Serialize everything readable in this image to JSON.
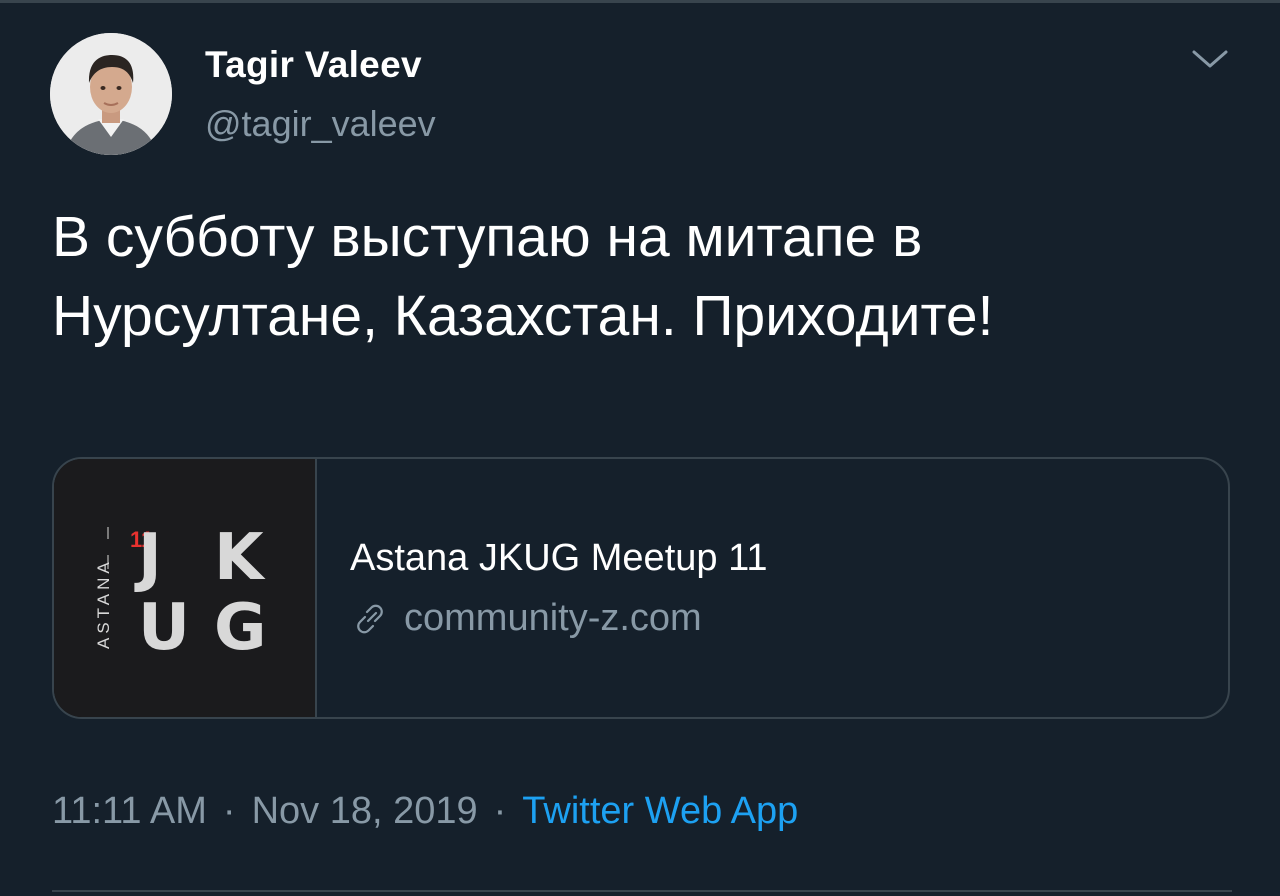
{
  "author": {
    "display_name": "Tagir Valeev",
    "handle": "@tagir_valeev",
    "avatar_icon": "person-photo"
  },
  "menu": {
    "caret_icon": "chevron-down-icon"
  },
  "tweet": {
    "text_lines": [
      "В субботу выступаю на митапе в",
      "Нурсултане, Казахстан. Приходите!"
    ]
  },
  "card": {
    "image_logo": {
      "vertical_text": "ASTANA",
      "number": "11",
      "letters": [
        "J",
        "K",
        "U",
        "G"
      ],
      "accent_color": "#e8322f"
    },
    "title": "Astana JKUG Meetup 11",
    "domain": "community-z.com",
    "link_icon": "link-icon"
  },
  "meta": {
    "time": "11:11 AM",
    "separator": "·",
    "date": "Nov 18, 2019",
    "source": "Twitter Web App"
  },
  "colors": {
    "background": "#15202b",
    "text": "#ffffff",
    "secondary": "#8899a6",
    "accent": "#1da1f2",
    "border": "#38444d"
  }
}
